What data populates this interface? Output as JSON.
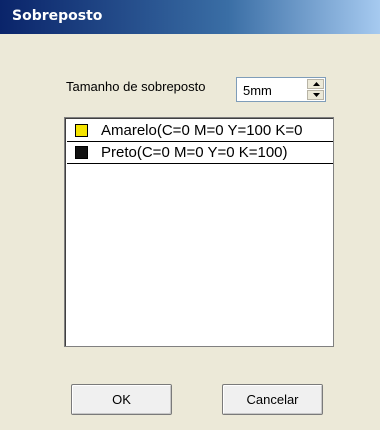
{
  "window": {
    "title": "Sobreposto"
  },
  "overlap": {
    "label": "Tamanho de sobreposto",
    "value": "5mm"
  },
  "list": {
    "items": [
      {
        "label": "Amarelo(C=0 M=0 Y=100 K=0",
        "color": "#f5e400"
      },
      {
        "label": "Preto(C=0 M=0 Y=0 K=100)",
        "color": "#111111"
      }
    ]
  },
  "buttons": {
    "ok": "OK",
    "cancel": "Cancelar"
  },
  "icons": {
    "spin_up": "arrow-up-icon",
    "spin_down": "arrow-down-icon"
  }
}
